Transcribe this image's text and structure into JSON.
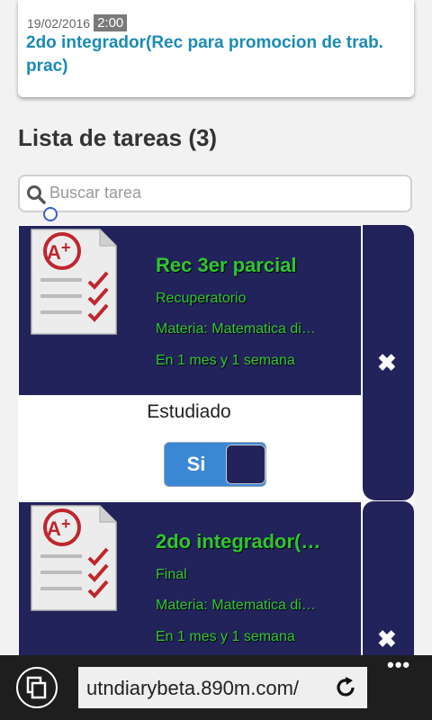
{
  "top_card": {
    "date": "19/02/2016",
    "time": "2:00",
    "title": "2do integrador(Rec para promocion de trab. prac)"
  },
  "section_title": "Lista de tareas (3)",
  "search": {
    "placeholder": "Buscar tarea",
    "value": ""
  },
  "tasks": [
    {
      "title": "Rec 3er parcial",
      "type": "Recuperatorio",
      "subject": "Materia: Matematica di…",
      "due": "En 1 mes y 1 semana",
      "studied_label": "Estudiado",
      "toggle_label": "Si",
      "delete": "✖"
    },
    {
      "title": "2do integrador(…",
      "type": "Final",
      "subject": "Materia: Matematica di…",
      "due": "En 1 mes y 1 semana",
      "delete": "✖"
    }
  ],
  "browser": {
    "url": "utndiarybeta.890m.com/",
    "more": "•••"
  },
  "icons": {
    "search": "search-icon",
    "task": "grade-a-plus-checklist-icon",
    "delete": "close-icon",
    "tabs": "tabs-icon",
    "refresh": "refresh-icon",
    "more": "more-icon"
  },
  "colors": {
    "accent_blue": "#1a8bb5",
    "task_bg": "#23235b",
    "task_text": "#2fc62f",
    "toggle_on": "#3a87d4"
  }
}
